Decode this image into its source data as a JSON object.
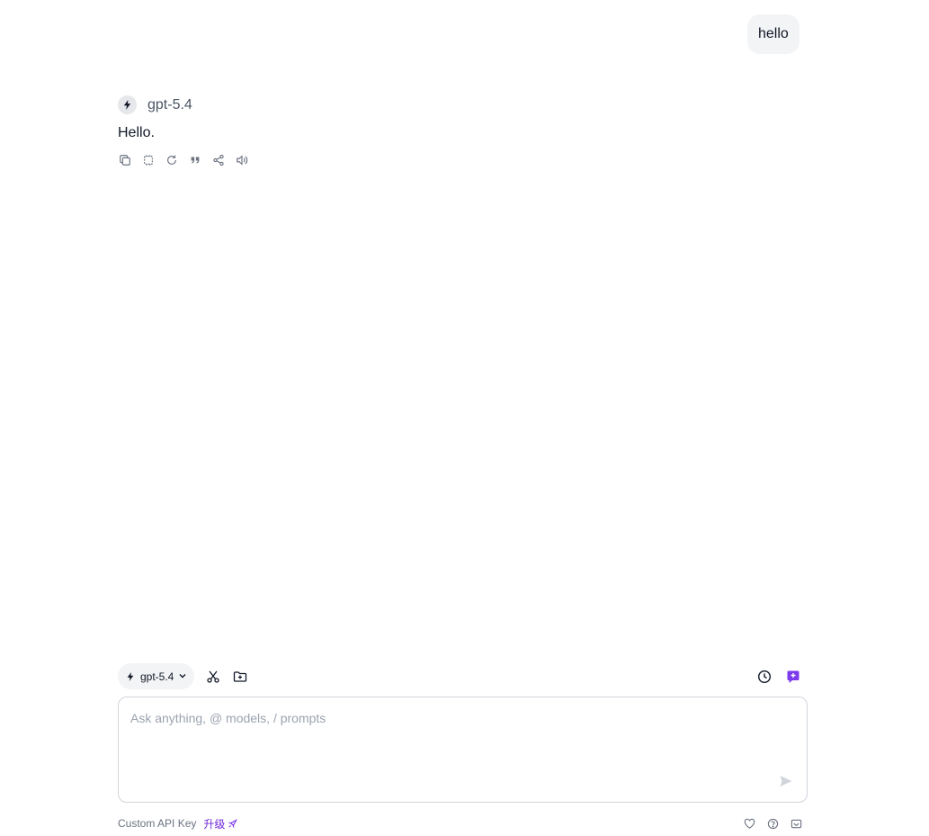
{
  "conversation": {
    "user_message": "hello",
    "assistant": {
      "model_name": "gpt-5.4",
      "reply": "Hello."
    },
    "message_actions": [
      "copy-icon",
      "copy-plain-icon",
      "regenerate-icon",
      "quote-icon",
      "share-icon",
      "read-aloud-icon"
    ]
  },
  "toolbar": {
    "model_selector_label": "gpt-5.4",
    "accent_color": "#7c3aed"
  },
  "input": {
    "placeholder": "Ask anything, @ models, / prompts",
    "value": ""
  },
  "footer": {
    "api_key_label": "Custom API Key",
    "upgrade_label": "升级"
  }
}
